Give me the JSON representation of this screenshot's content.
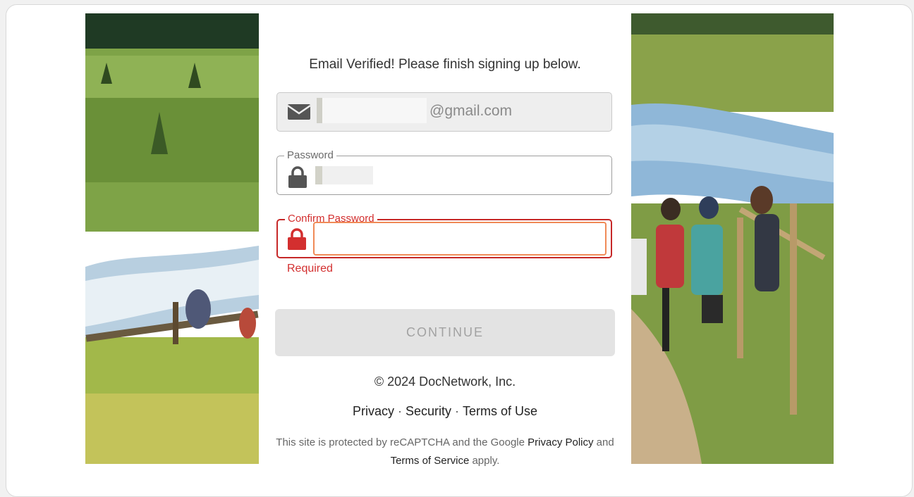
{
  "signup": {
    "heading": "Email Verified! Please finish signing up below.",
    "email": {
      "value_suffix": "@gmail.com",
      "icon": "envelope-icon"
    },
    "password": {
      "label": "Password",
      "icon": "lock-icon"
    },
    "confirm_password": {
      "label": "Confirm Password",
      "icon": "lock-icon",
      "error": "Required"
    },
    "continue_label": "CONTINUE"
  },
  "footer": {
    "copyright": "© 2024 DocNetwork, Inc.",
    "links": {
      "privacy": "Privacy",
      "security": "Security",
      "terms": "Terms of Use",
      "separator": "·"
    },
    "recaptcha": {
      "text_before": "This site is protected by reCAPTCHA and the Google",
      "privacy_policy": "Privacy Policy",
      "and": "and",
      "terms_of_service": "Terms of Service",
      "apply": "apply."
    }
  },
  "colors": {
    "error": "#d32f2f",
    "focus_outline": "#f08a57",
    "button_disabled_bg": "#e3e3e3"
  }
}
